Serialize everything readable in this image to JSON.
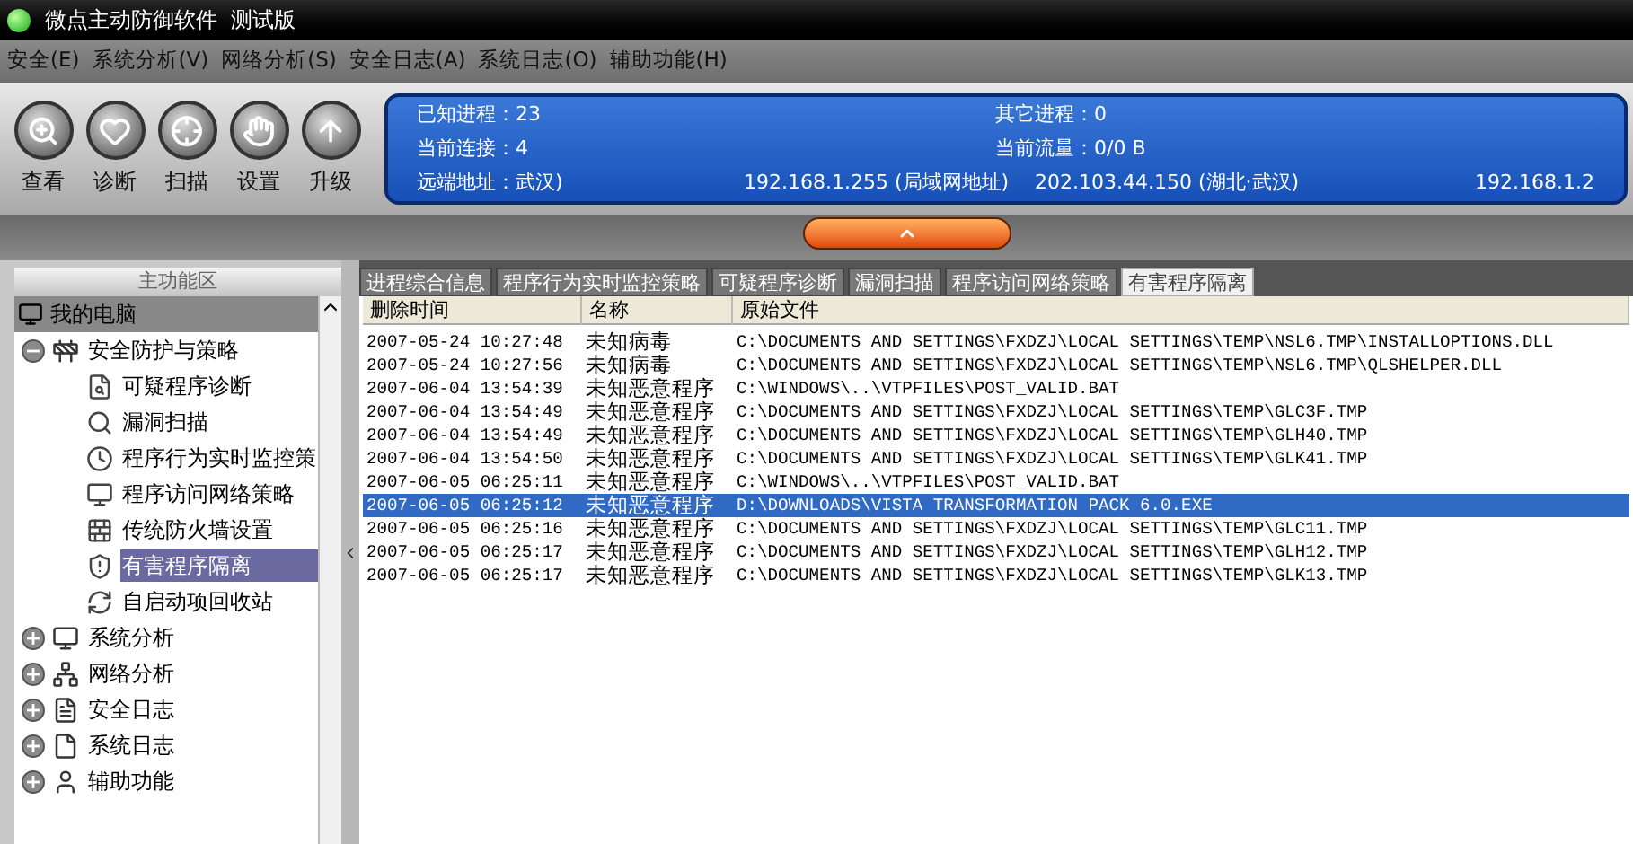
{
  "window": {
    "title": "微点主动防御软件  测试版"
  },
  "menu": [
    "安全(E)",
    "系统分析(V)",
    "网络分析(S)",
    "安全日志(A)",
    "系统日志(O)",
    "辅助功能(H)"
  ],
  "toolbar": [
    "查看",
    "诊断",
    "扫描",
    "设置",
    "升级"
  ],
  "info": {
    "row_1": [
      "已知进程：23",
      "其它进程：0"
    ],
    "row_2": [
      "当前连接：4",
      "当前流量：0/0 B"
    ],
    "row_3": [
      "远端地址：武汉)",
      "192.168.1.255 (局域网地址)",
      "202.103.44.150 (湖北·武汉)",
      "192.168.1.2"
    ]
  },
  "sidebar": {
    "title": "主功能区",
    "tree": [
      {
        "label": "我的电脑",
        "selected": false,
        "children": [
          {
            "label": "安全防护与策略",
            "expanded": true,
            "selected": false,
            "children": [
              {
                "label": "可疑程序诊断",
                "selected": false
              },
              {
                "label": "漏洞扫描",
                "selected": false
              },
              {
                "label": "程序行为实时监控策",
                "selected": false
              },
              {
                "label": "程序访问网络策略",
                "selected": false
              },
              {
                "label": "传统防火墙设置",
                "selected": false
              },
              {
                "label": "有害程序隔离",
                "selected": true
              },
              {
                "label": "自启动项回收站",
                "selected": false
              }
            ]
          },
          {
            "label": "系统分析",
            "expanded": false,
            "selected": false
          },
          {
            "label": "网络分析",
            "expanded": false,
            "selected": false
          },
          {
            "label": "安全日志",
            "expanded": false,
            "selected": false
          },
          {
            "label": "系统日志",
            "expanded": false,
            "selected": false
          },
          {
            "label": "辅助功能",
            "expanded": false,
            "selected": false
          }
        ]
      }
    ]
  },
  "tabs": [
    {
      "label": "进程综合信息",
      "selected": false
    },
    {
      "label": "程序行为实时监控策略",
      "selected": false
    },
    {
      "label": "可疑程序诊断",
      "selected": false
    },
    {
      "label": "漏洞扫描",
      "selected": false
    },
    {
      "label": "程序访问网络策略",
      "selected": false
    },
    {
      "label": "有害程序隔离",
      "selected": true
    }
  ],
  "table": {
    "columns": [
      "删除时间",
      "名称",
      "原始文件"
    ],
    "rows": [
      {
        "cells": [
          "2007-05-24 10:27:48",
          "未知病毒",
          "C:\\DOCUMENTS AND SETTINGS\\FXDZJ\\LOCAL SETTINGS\\TEMP\\NSL6.TMP\\INSTALLOPTIONS.DLL"
        ],
        "selected": false
      },
      {
        "cells": [
          "2007-05-24 10:27:56",
          "未知病毒",
          "C:\\DOCUMENTS AND SETTINGS\\FXDZJ\\LOCAL SETTINGS\\TEMP\\NSL6.TMP\\QLSHELPER.DLL"
        ],
        "selected": false
      },
      {
        "cells": [
          "2007-06-04 13:54:39",
          "未知恶意程序",
          "C:\\WINDOWS\\..\\VTPFILES\\POST_VALID.BAT"
        ],
        "selected": false
      },
      {
        "cells": [
          "2007-06-04 13:54:49",
          "未知恶意程序",
          "C:\\DOCUMENTS AND SETTINGS\\FXDZJ\\LOCAL SETTINGS\\TEMP\\GLC3F.TMP"
        ],
        "selected": false
      },
      {
        "cells": [
          "2007-06-04 13:54:49",
          "未知恶意程序",
          "C:\\DOCUMENTS AND SETTINGS\\FXDZJ\\LOCAL SETTINGS\\TEMP\\GLH40.TMP"
        ],
        "selected": false
      },
      {
        "cells": [
          "2007-06-04 13:54:50",
          "未知恶意程序",
          "C:\\DOCUMENTS AND SETTINGS\\FXDZJ\\LOCAL SETTINGS\\TEMP\\GLK41.TMP"
        ],
        "selected": false
      },
      {
        "cells": [
          "2007-06-05 06:25:11",
          "未知恶意程序",
          "C:\\WINDOWS\\..\\VTPFILES\\POST_VALID.BAT"
        ],
        "selected": false
      },
      {
        "cells": [
          "2007-06-05 06:25:12",
          "未知恶意程序",
          "D:\\DOWNLOADS\\VISTA TRANSFORMATION PACK 6.0.EXE"
        ],
        "selected": true
      },
      {
        "cells": [
          "2007-06-05 06:25:16",
          "未知恶意程序",
          "C:\\DOCUMENTS AND SETTINGS\\FXDZJ\\LOCAL SETTINGS\\TEMP\\GLC11.TMP"
        ],
        "selected": false
      },
      {
        "cells": [
          "2007-06-05 06:25:17",
          "未知恶意程序",
          "C:\\DOCUMENTS AND SETTINGS\\FXDZJ\\LOCAL SETTINGS\\TEMP\\GLH12.TMP"
        ],
        "selected": false
      },
      {
        "cells": [
          "2007-06-05 06:25:17",
          "未知恶意程序",
          "C:\\DOCUMENTS AND SETTINGS\\FXDZJ\\LOCAL SETTINGS\\TEMP\\GLK13.TMP"
        ],
        "selected": false
      }
    ]
  }
}
